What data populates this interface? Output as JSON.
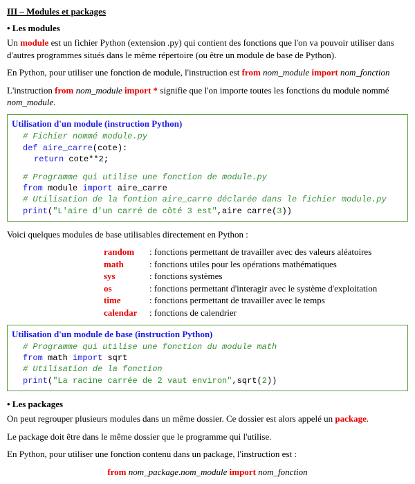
{
  "title": "III – Modules et packages",
  "sub1": "• Les modules",
  "p1a": "Un ",
  "p1_module": "module",
  "p1b": " est un fichier Python (extension .py) qui contient des fonctions que l'on va pouvoir utiliser dans d'autres programmes situés dans le même répertoire (ou être un module de base de Python).",
  "p2a": "En Python, pour utiliser une fonction de module, l'instruction est ",
  "p2_from": "from",
  "p2_nm": " nom_module ",
  "p2_import": "import",
  "p2_nf": " nom_fonction",
  "p3a": "L'instruction ",
  "p3_from": "from",
  "p3_nm": " nom_module ",
  "p3_import": "import",
  "p3_star": " *",
  "p3b": " signifie que l'on importe toutes les fonctions du module nommé ",
  "p3_nm2": "nom_module",
  "p3c": ".",
  "box1_title": "Utilisation d'un module (instruction Python)",
  "b1_l1": "# Fichier nommé module.py",
  "b1_l2_def": "def ",
  "b1_l2_fn": "aire_carre",
  "b1_l2_rest": "(cote):",
  "b1_l3_ret": "return ",
  "b1_l3_rest": "cote**2;",
  "b1_l4": "# Programme qui utilise une fonction de module.py",
  "b1_l5_from": "from ",
  "b1_l5_mod": "module ",
  "b1_l5_imp": "import ",
  "b1_l5_name": "aire_carre",
  "b1_l6": "# Utilisation de la fontion aire_carre déclarée dans le fichier module.py",
  "b1_l7_print": "print",
  "b1_l7_p1": "(",
  "b1_l7_str": "\"L'aire d'un carré de côté 3 est\"",
  "b1_l7_mid": ",aire carre(",
  "b1_l7_num": "3",
  "b1_l7_end": "))",
  "p4": "Voici quelques modules de base utilisables directement en Python :",
  "mods": [
    {
      "name": "random",
      "desc": ": fonctions permettant de travailler avec des valeurs aléatoires"
    },
    {
      "name": "math",
      "desc": ": fonctions utiles pour les opérations mathématiques"
    },
    {
      "name": "sys",
      "desc": ": fonctions systèmes"
    },
    {
      "name": "os",
      "desc": ": fonctions permettant d'interagir avec le système d'exploitation"
    },
    {
      "name": "time",
      "desc": ": fonctions permettant de travailler avec le temps"
    },
    {
      "name": "calendar",
      "desc": ": fonctions de calendrier"
    }
  ],
  "box2_title": "Utilisation d'un module de base (instruction Python)",
  "b2_l1": "# Programme qui utilise une fonction du module math",
  "b2_l2_from": "from ",
  "b2_l2_mod": "math ",
  "b2_l2_imp": "import ",
  "b2_l2_name": "sqrt",
  "b2_l3": "# Utilisation de la fonction",
  "b2_l4_print": "print",
  "b2_l4_p1": "(",
  "b2_l4_str": "\"La racine carrée de 2 vaut environ\"",
  "b2_l4_mid": ",sqrt(",
  "b2_l4_num": "2",
  "b2_l4_end": "))",
  "sub2": "• Les packages",
  "p5a": "On peut regrouper plusieurs modules dans un même dossier. Ce dossier est alors appelé un ",
  "p5_pkg": "package",
  "p5b": ".",
  "p6": "Le package doit être dans le même dossier que le programme qui l'utilise.",
  "p7": "En Python, pour utiliser une fonction contenu dans un package, l'instruction est :",
  "p8_from": "from",
  "p8_np": " nom_package",
  "p8_dot": ".",
  "p8_nm": "nom_module ",
  "p8_import": "import",
  "p8_nf": " nom_fonction"
}
